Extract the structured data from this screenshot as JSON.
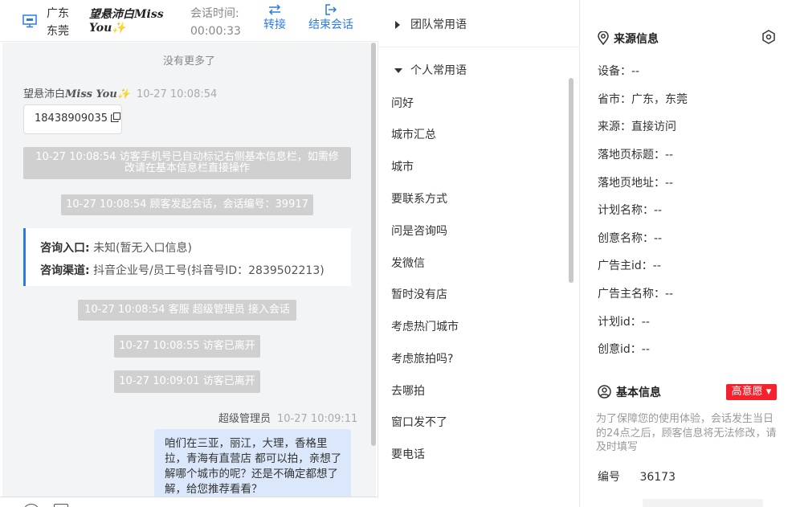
{
  "header": {
    "location_line1": "广东",
    "location_line2": "东莞",
    "name_line1": "望悬沛白Miss",
    "name_line2": "You✨",
    "time_label": "会话时间:",
    "time_value": "00:00:33",
    "transfer_label": "转接",
    "end_label": "结束会话"
  },
  "chat": {
    "no_more": "没有更多了",
    "visitor_nick_plain": "望悬沛白",
    "visitor_nick_fancy": "Miss You✨",
    "visitor_time": "10-27 10:08:54",
    "phone": "18438909035",
    "sys1_line1": "10-27 10:08:54 访客手机号已自动标记右侧基本信息栏，如需修",
    "sys1_line2": "改请在基本信息栏直接操作",
    "sys2": "10-27 10:08:54 顾客发起会话，会话编号：39917",
    "entry_label": "咨询入口:",
    "entry_value": "未知(暂无入口信息)",
    "channel_label": "咨询渠道:",
    "channel_value": "抖音企业号/员工号(抖音号ID：2839502213)",
    "sys3": "10-27 10:08:54 客服 超级管理员 接入会话",
    "sys4": "10-27 10:08:55 访客已离开",
    "sys5": "10-27 10:09:01 访客已离开",
    "agent_nick": "超级管理员",
    "agent_time": "10-27 10:09:11",
    "agent_msg": "咱们在三亚，丽江，大理，香格里拉，青海有直营店 都可以拍，亲想了解哪个城市的呢？还是不确定都想了解，给您推荐看看？"
  },
  "phrases": {
    "team_group": "团队常用语",
    "personal_group": "个人常用语",
    "items": [
      "问好",
      "城市汇总",
      "城市",
      "要联系方式",
      "问是咨询吗",
      "发微信",
      "暂时没有店",
      "考虑热门城市",
      "考虑旅拍吗?",
      "去哪拍",
      "窗口发不了",
      "要电话"
    ]
  },
  "info": {
    "source_title": "来源信息",
    "fields": [
      "设备：--",
      "省市：广东，东莞",
      "来源：直接访问",
      "落地页标题：--",
      "落地页地址：--",
      "计划名称：--",
      "创意名称：--",
      "广告主id：--",
      "广告主名称：--",
      "计划id：--",
      "创意id：--"
    ],
    "basic_title": "基本信息",
    "intent_tag": "高意愿 ▾",
    "hint": "为了保障您的使用体验，会话发生当日的24点之后，顾客信息将无法修改，请及时填写",
    "id_label": "编号",
    "id_value": "36173"
  },
  "colors": {
    "accent": "#2c7be5",
    "tag_red": "#f5222d",
    "sys_gray": "#d0d0d0",
    "agent_bubble": "#dbe8fb"
  }
}
